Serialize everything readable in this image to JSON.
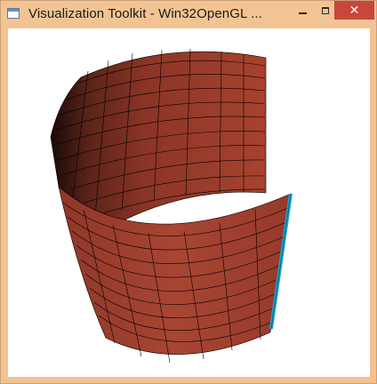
{
  "window": {
    "title": "Visualization Toolkit - Win32OpenGL ...",
    "icon": "vtk-app-icon",
    "controls": {
      "minimize_icon": "minimize-icon",
      "maximize_icon": "maximize-icon",
      "close_label": "✕"
    }
  },
  "render": {
    "background": "#ffffff",
    "surface_color": "#9a3a2c",
    "edge_color": "#000000",
    "highlight_edge_color": "#1aa6d8"
  }
}
